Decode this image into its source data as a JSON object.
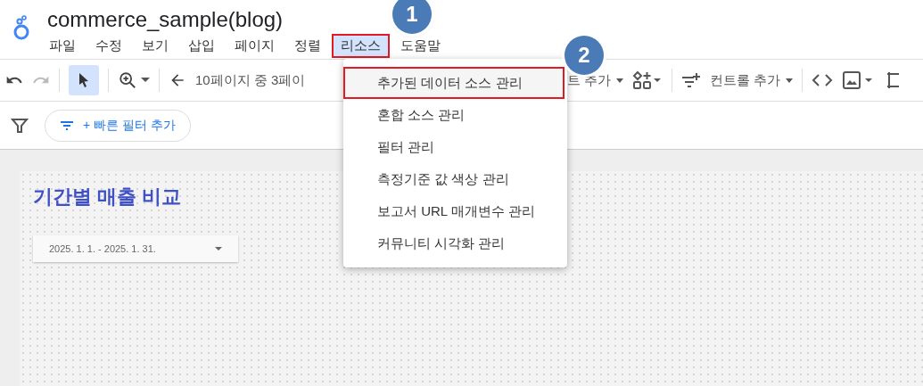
{
  "app": {
    "title": "commerce_sample(blog)"
  },
  "menu_bar": [
    {
      "label": "파일",
      "selected": false
    },
    {
      "label": "수정",
      "selected": false
    },
    {
      "label": "보기",
      "selected": false
    },
    {
      "label": "삽입",
      "selected": false
    },
    {
      "label": "페이지",
      "selected": false
    },
    {
      "label": "정렬",
      "selected": false
    },
    {
      "label": "리소스",
      "selected": true
    },
    {
      "label": "도움말",
      "selected": false
    }
  ],
  "toolbar": {
    "page_indicator": "10페이지 중 3페이",
    "add_chart": "트 추가",
    "add_control": "컨트롤 추가"
  },
  "filter_bar": {
    "quick_filter_button": "+ 빠른 필터 추가"
  },
  "dropdown_menu": [
    {
      "label": "추가된 데이터 소스 관리",
      "highlighted": true
    },
    {
      "label": "혼합 소스 관리",
      "highlighted": false
    },
    {
      "label": "필터 관리",
      "highlighted": false
    },
    {
      "label": "측정기준 값 색상 관리",
      "highlighted": false
    },
    {
      "label": "보고서 URL 매개변수 관리",
      "highlighted": false
    },
    {
      "label": "커뮤니티 시각화 관리",
      "highlighted": false
    }
  ],
  "annotations": [
    {
      "label": "1"
    },
    {
      "label": "2"
    }
  ],
  "report": {
    "title": "기간별 매출 비교",
    "date_range": "2025. 1. 1. - 2025. 1. 31."
  }
}
